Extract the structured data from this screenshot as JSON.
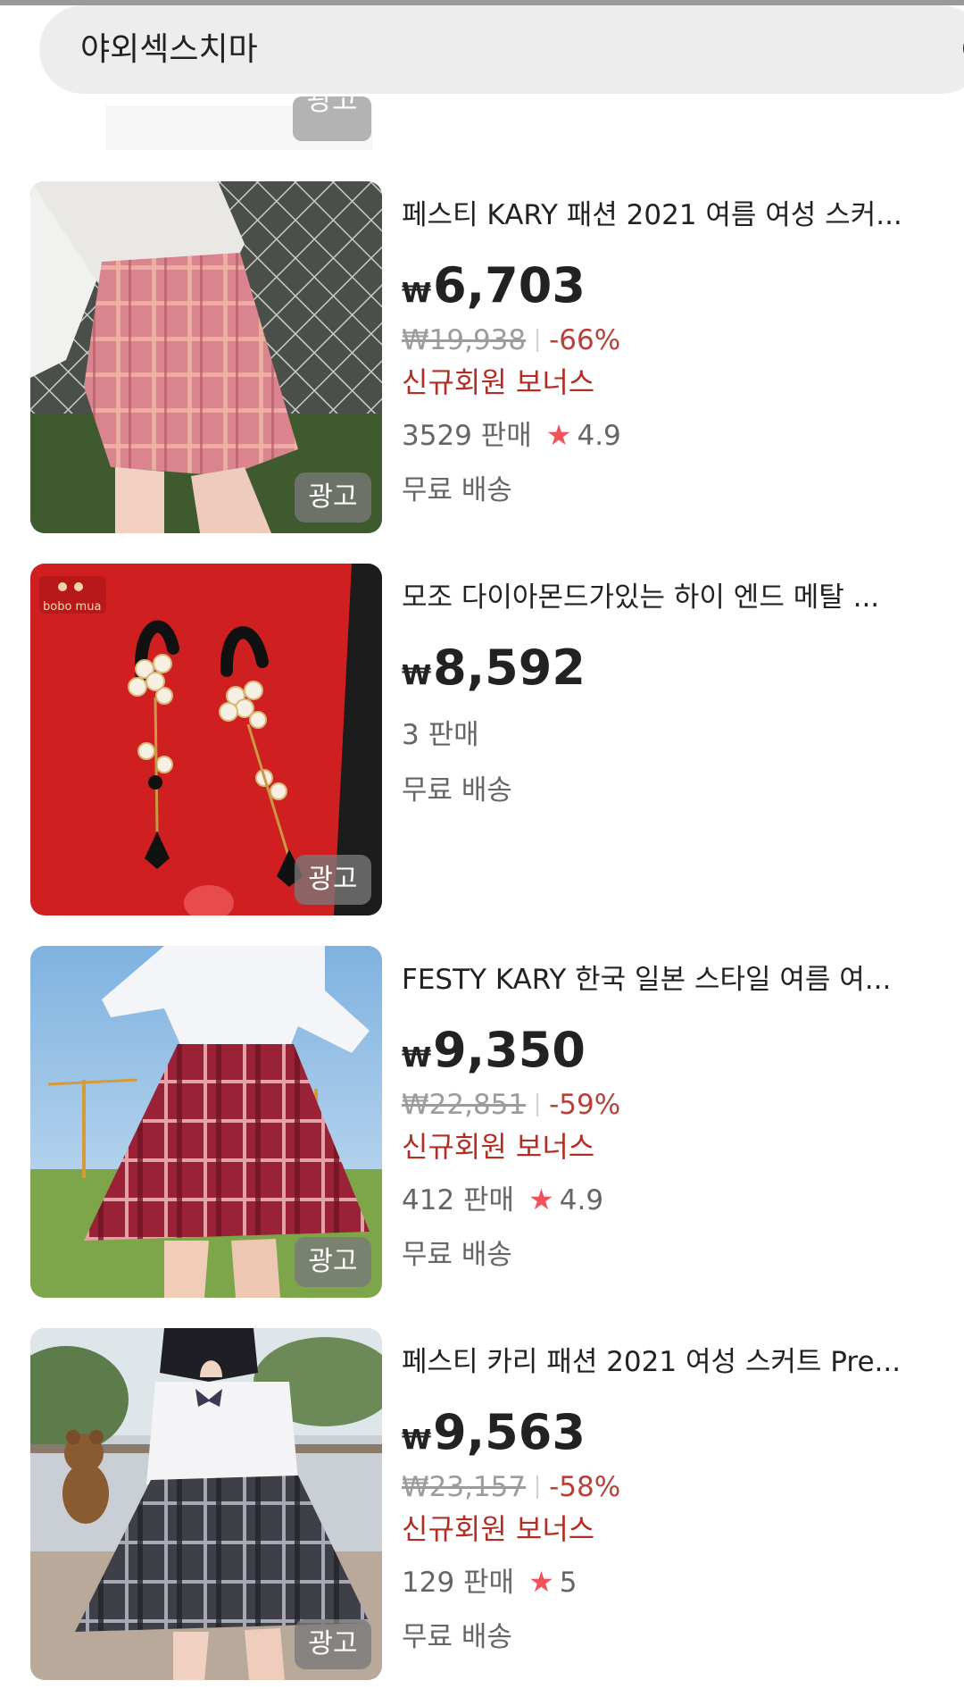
{
  "search": {
    "query": "야외섹스치마"
  },
  "previous_item": {
    "ad_label": "광고"
  },
  "products": [
    {
      "title": "페스티 KARY 패션 2021 여름 여성 스커...",
      "currency": "₩",
      "price": "6,703",
      "original_price": "₩19,938",
      "discount": "-66%",
      "bonus": "신규회원 보너스",
      "sold": "3529 판매",
      "rating": "4.9",
      "shipping": "무료 배송",
      "ad_label": "광고",
      "image": "pink-plaid-skirt"
    },
    {
      "title": "모조 다이아몬드가있는 하이 엔드 메탈 ...",
      "currency": "₩",
      "price": "8,592",
      "sold": "3 판매",
      "shipping": "무료 배송",
      "ad_label": "광고",
      "image_logo": "bobo mua",
      "image": "pearl-jewelry"
    },
    {
      "title": "FESTY KARY 한국 일본 스타일 여름 여...",
      "currency": "₩",
      "price": "9,350",
      "original_price": "₩22,851",
      "discount": "-59%",
      "bonus": "신규회원 보너스",
      "sold": "412 판매",
      "rating": "4.9",
      "shipping": "무료 배송",
      "ad_label": "광고",
      "image": "red-plaid-skirt"
    },
    {
      "title": "페스티 카리 패션 2021 여성 스커트 Pre...",
      "currency": "₩",
      "price": "9,563",
      "original_price": "₩23,157",
      "discount": "-58%",
      "bonus": "신규회원 보너스",
      "sold": "129 판매",
      "rating": "5",
      "shipping": "무료 배송",
      "ad_label": "광고",
      "image": "gray-plaid-skirt"
    }
  ],
  "colors": {
    "discount": "#b6413a",
    "bonus": "#b02e24",
    "star": "#f2525c",
    "search_bg": "#ededed"
  }
}
